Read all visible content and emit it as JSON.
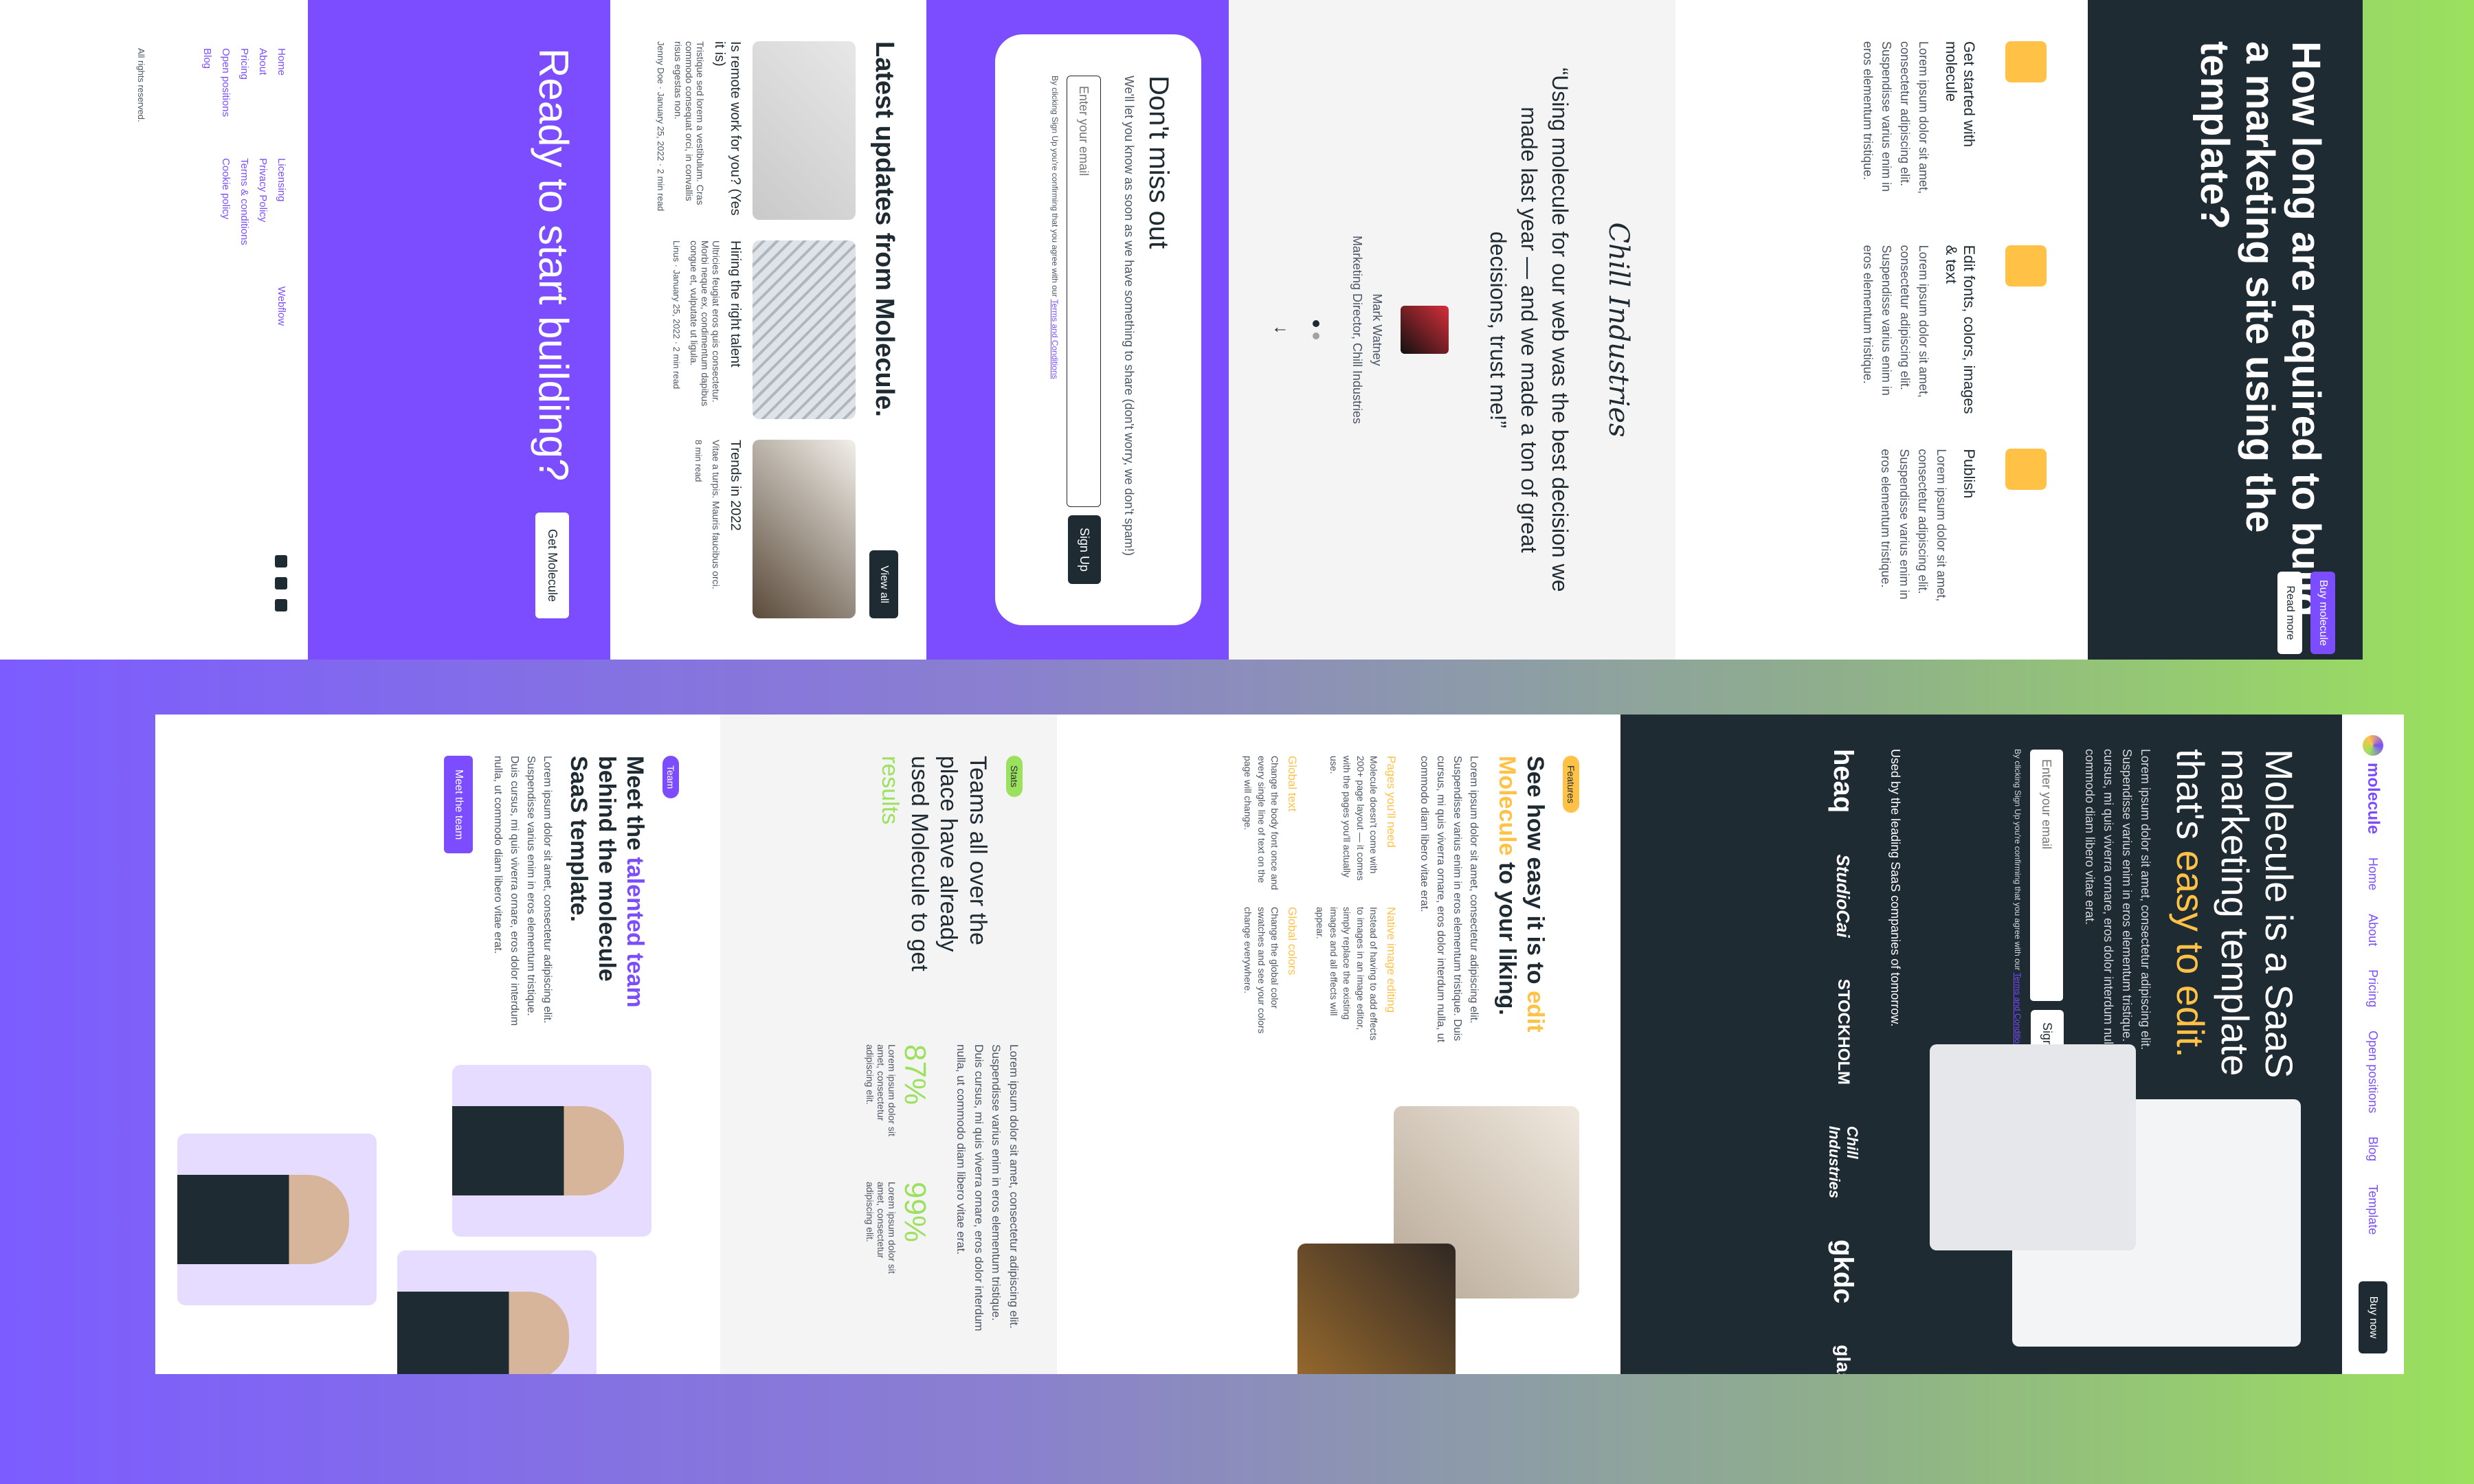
{
  "top": {
    "cta": {
      "heading": "How long are required to build a marketing site using the template?"
    },
    "side_tabs": {
      "buy": "Buy molecule",
      "read_more": "Read more"
    },
    "features": [
      {
        "title": "Get started with molecule",
        "text": "Lorem ipsum dolor sit amet, consectetur adipiscing elit. Suspendisse varius enim in eros elementum tristique."
      },
      {
        "title": "Edit fonts, colors, images & text",
        "text": "Lorem ipsum dolor sit amet, consectetur adipiscing elit. Suspendisse varius enim in eros elementum tristique."
      },
      {
        "title": "Publish",
        "text": "Lorem ipsum dolor sit amet, consectetur adipiscing elit. Suspendisse varius enim in eros elementum tristique."
      }
    ],
    "testimonial": {
      "company": "Chill Industries",
      "quote": "“Using molecule for our web was the best decision we made last year — and we made a ton of great decisions, trust me!”",
      "name": "Mark Watney",
      "role": "Marketing Director, Chill Industries"
    },
    "newsletter": {
      "heading": "Don't miss out",
      "text": "We'll let you know as soon as we have something to share (don't worry, we don't spam!)",
      "placeholder": "Enter your email",
      "button": "Sign Up",
      "note": "By clicking Sign Up you're confirming that you agree with our",
      "terms": "Terms and Conditions"
    },
    "blog": {
      "heading": "Latest updates from Molecule.",
      "view_all": "View all",
      "posts": [
        {
          "title": "Is remote work for you? (Yes it is)",
          "excerpt": "Tristique sed lorem a vestibulum. Cras commodo consequat orci, in convallis risus egestas non.",
          "author": "Jenny Doe",
          "date": "January 25, 2022",
          "read": "2 min read"
        },
        {
          "title": "Hiring the right talent",
          "excerpt": "Ultricies feugiat eros quis consectetur. Morbi neque ex, condimentum dapibus congue et, vulputate ut ligula.",
          "author": "Linus",
          "date": "January 25, 2022",
          "read": "2 min read"
        },
        {
          "title": "Trends in 2022",
          "excerpt": "Vitae a turpis. Mauris faucibus orci.",
          "author": "",
          "date": "",
          "read": "8 min read"
        }
      ]
    },
    "footer": {
      "heading": "Ready to start building?",
      "button": "Get Molecule",
      "links_main": [
        "Home",
        "About",
        "Pricing",
        "Open positions",
        "Blog"
      ],
      "links_legal": [
        "Licensing",
        "Privacy Policy",
        "Terms & conditions",
        "Cookie policy"
      ],
      "links_web": [
        "Webflow"
      ],
      "rights": "All rights reserved."
    }
  },
  "bottom": {
    "nav": {
      "brand": "molecule",
      "links": [
        "Home",
        "About",
        "Pricing",
        "Open positions",
        "Blog",
        "Template"
      ],
      "buy": "Buy now"
    },
    "hero": {
      "heading_a": "Molecule is a SaaS marketing template that's",
      "heading_b": "easy to edit.",
      "text": "Lorem ipsum dolor sit amet, consectetur adipiscing elit. Suspendisse varius enim in eros elementum tristique. Duis cursus, mi quis viverra ornare, eros dolor interdum nulla, ut commodo diam libero vitae erat.",
      "placeholder": "Enter your email",
      "button": "Sign Up",
      "note": "By clicking Sign Up you're confirming that you agree with our",
      "terms": "Terms and Conditions",
      "used_by": "Used by the leading SaaS companies of tomorrow.",
      "logos": [
        "heaq",
        "StudioCai",
        "STOCKHOLM",
        "Chill Industries",
        "gkdc",
        "glassware"
      ]
    },
    "features": {
      "pill": "Features",
      "heading_a": "See how easy it is to",
      "heading_b": "edit",
      "heading_c": "Molecule",
      "heading_d": "to your liking.",
      "text": "Lorem ipsum dolor sit amet, consectetur adipiscing elit. Suspendisse varius enim in eros elementum tristique. Duis cursus, mi quis viverra ornare, eros dolor interdum nulla, ut commodo diam libero vitae erat.",
      "items": [
        {
          "title": "Pages you'll need",
          "text": "Molecule doesn't come with 200+ page layout — it comes with the pages you'll actually use."
        },
        {
          "title": "Native image editing",
          "text": "Instead of having to add effects to images in an image editor, simply replace the existing images and all effects will appear."
        },
        {
          "title": "Global text",
          "text": "Change the body font once and every single line of text on the page will change."
        },
        {
          "title": "Global colors",
          "text": "Change the global color swatches and see your colors change everywhere."
        }
      ]
    },
    "stats": {
      "pill": "Stats",
      "heading_a": "Teams all over the place have already used Molecule to get",
      "heading_b": "results",
      "text": "Lorem ipsum dolor sit amet, consectetur adipiscing elit. Suspendisse varius enim in eros elementum tristique. Duis cursus, mi quis viverra ornare, eros dolor interdum nulla, ut commodo diam libero vitae erat.",
      "items": [
        {
          "n": "87%",
          "text": "Lorem ipsum dolor sit amet, consectetur adipiscing elit."
        },
        {
          "n": "99%",
          "text": "Lorem ipsum dolor sit amet, consectetur adipiscing elit."
        }
      ]
    },
    "team": {
      "pill": "Team",
      "heading_a": "Meet the",
      "heading_b": "talented team",
      "heading_c": "behind the molecule SaaS template.",
      "text": "Lorem ipsum dolor sit amet, consectetur adipiscing elit. Suspendisse varius enim in eros elementum tristique. Duis cursus, mi quis viverra ornare, eros dolor interdum nulla, ut commodo diam libero vitae erat.",
      "button": "Meet the team"
    }
  }
}
